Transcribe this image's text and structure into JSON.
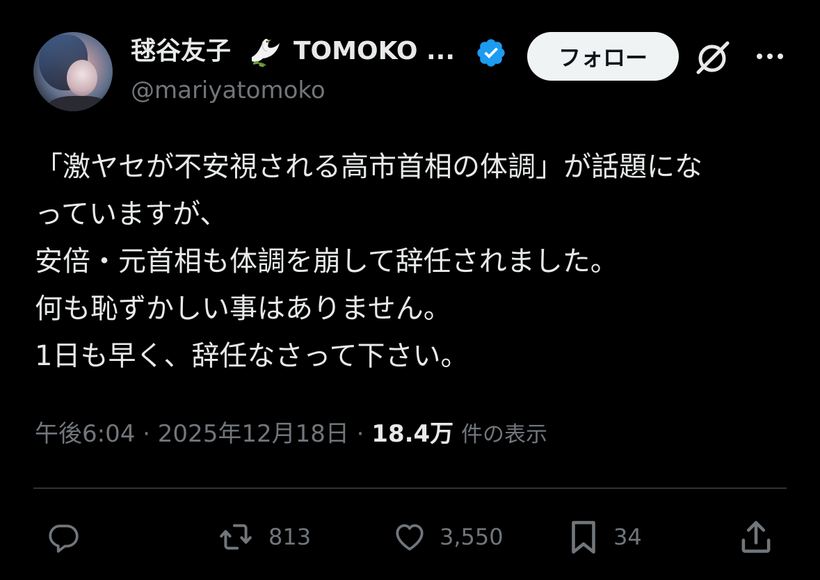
{
  "author": {
    "name_jp": "毬谷友子",
    "name_en": "TOMOKO ...",
    "handle": "@mariyatomoko",
    "verified": true,
    "verified_color": "#1d9bf0"
  },
  "header": {
    "follow_label": "フォロー",
    "grok_icon": "grok-icon",
    "more_icon": "more-icon"
  },
  "tweet": {
    "lines": [
      "「激ヤセが不安視される高市首相の体調」が話題にな",
      "っていますが、",
      "安倍・元首相も体調を崩して辞任されました。",
      "何も恥ずかしい事はありません。",
      "1日も早く、辞任なさって下さい。"
    ]
  },
  "meta": {
    "time": "午後6:04",
    "separator": "·",
    "date": "2025年12月18日",
    "views_count": "18.4万",
    "views_label": "件の表示"
  },
  "actions": {
    "reply_count": "",
    "retweet_count": "813",
    "like_count": "3,550",
    "bookmark_count": "34"
  },
  "colors": {
    "background": "#000000",
    "text": "#e7e9ea",
    "secondary": "#71767b",
    "divider": "#2f3336",
    "follow_bg": "#eff3f4"
  }
}
